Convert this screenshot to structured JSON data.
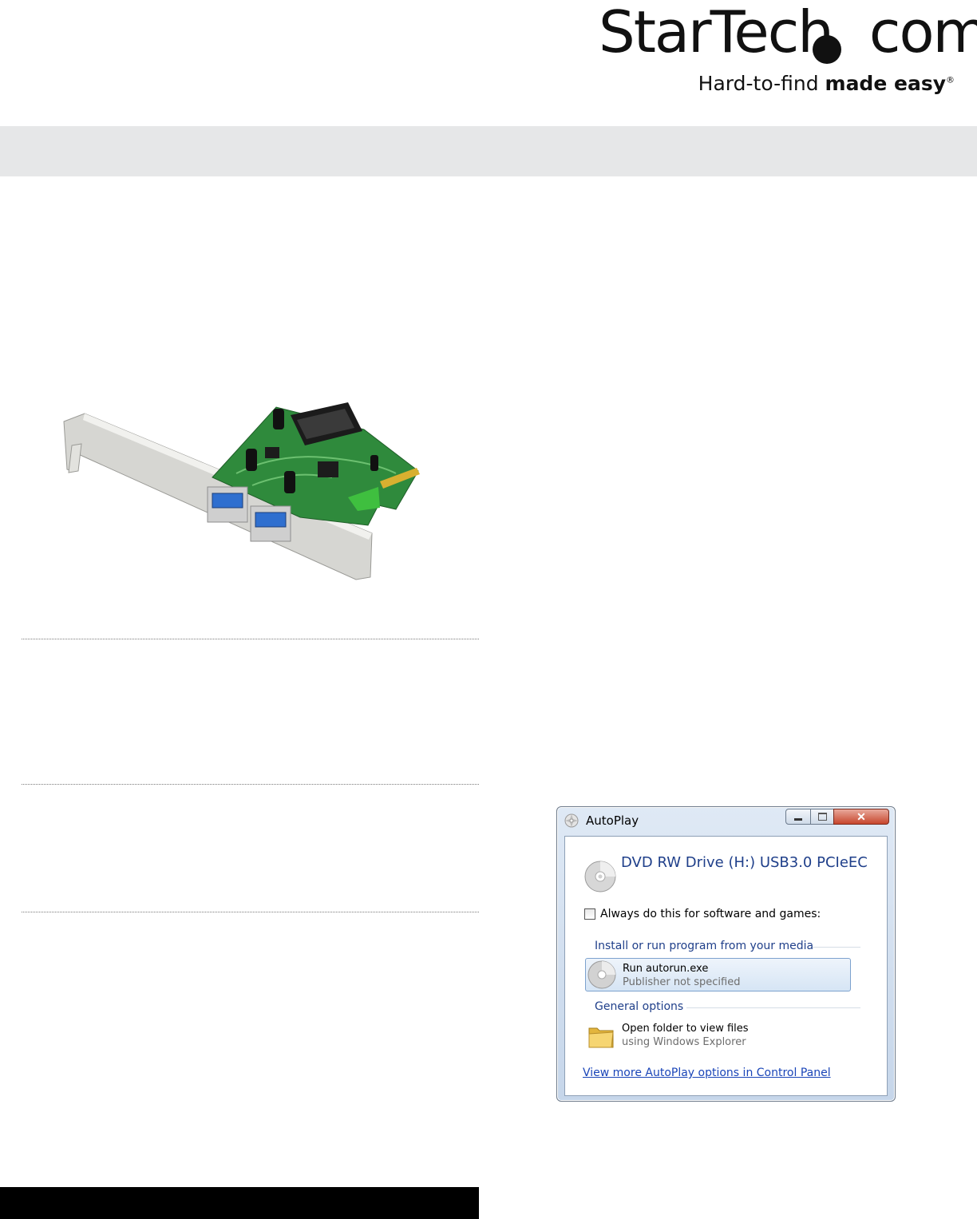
{
  "brand": {
    "wordmark": "StarTech",
    "wordmark_suffix": "com",
    "tagline_light": "Hard-to-find ",
    "tagline_bold": "made easy",
    "tagline_mark": "®"
  },
  "autoplay_dialog": {
    "title": "AutoPlay",
    "drive_name": "DVD RW Drive (H:) USB3.0 PCIeEC",
    "checkbox_label": "Always do this for software and games:",
    "checkbox_checked": false,
    "group_install": "Install or run program from your media",
    "option_run": {
      "title": "Run autorun.exe",
      "subtitle": "Publisher not specified"
    },
    "group_general": "General options",
    "option_folder": {
      "title": "Open folder to view files",
      "subtitle": "using Windows Explorer"
    },
    "more_link": "View more AutoPlay options in Control Panel",
    "close_glyph": "✕"
  },
  "icons": {
    "title": "autoplay-icon",
    "drive": "cd-icon",
    "run": "cd-icon",
    "folder": "folder-icon"
  }
}
